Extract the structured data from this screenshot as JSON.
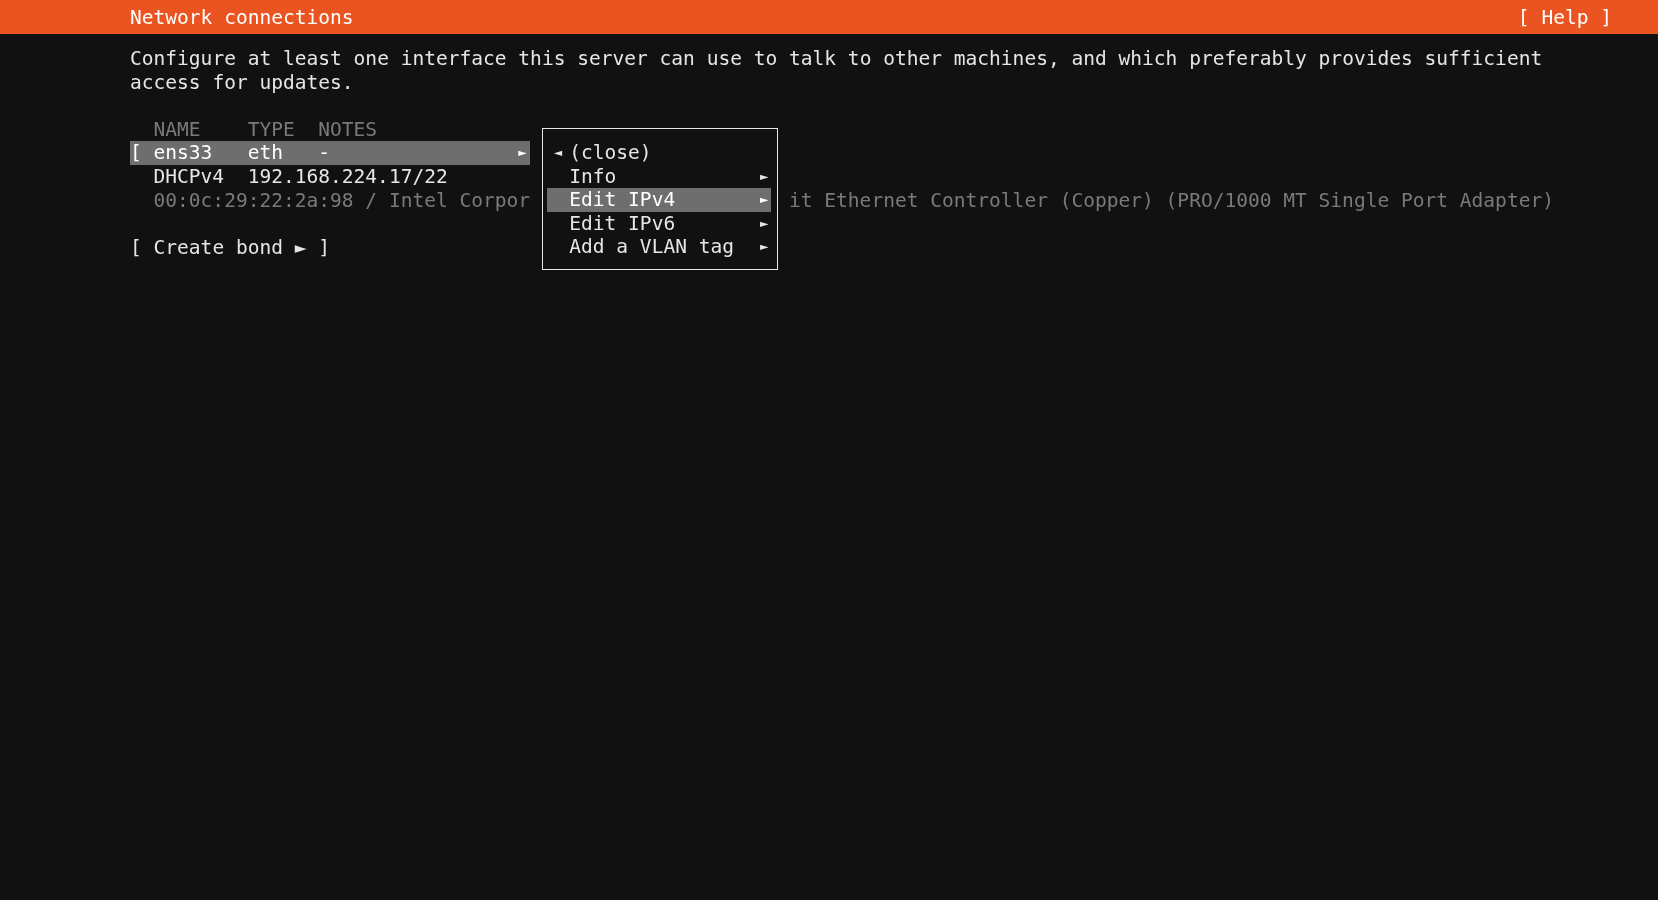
{
  "header": {
    "title": "Network connections",
    "help": "[ Help ]"
  },
  "description": "Configure at least one interface this server can use to talk to other machines, and which preferably provides sufficient access for updates.",
  "table": {
    "columns": [
      "NAME",
      "TYPE",
      "NOTES"
    ],
    "interface": {
      "bracket": "[",
      "name": "ens33",
      "type": "eth",
      "notes": "-",
      "arrow": "►",
      "selected": true
    },
    "address": {
      "method": "DHCPv4",
      "value": "192.168.224.17/22"
    },
    "hardware": {
      "visible_start": "00:0c:29:22:2a:98 / Intel Corpor",
      "visible_end": "it Ethernet Controller (Copper) (PRO/1000 MT Single Port Adapter)"
    }
  },
  "create_bond": "[ Create bond ► ]",
  "menu": [
    {
      "kind": "back",
      "label": "(close)",
      "arrow": "◄",
      "selected": false
    },
    {
      "kind": "submenu",
      "label": "Info",
      "arrow": "►",
      "selected": false
    },
    {
      "kind": "submenu",
      "label": "Edit IPv4",
      "arrow": "►",
      "selected": true
    },
    {
      "kind": "submenu",
      "label": "Edit IPv6",
      "arrow": "►",
      "selected": false
    },
    {
      "kind": "submenu",
      "label": "Add a VLAN tag",
      "arrow": "►",
      "selected": false
    }
  ]
}
